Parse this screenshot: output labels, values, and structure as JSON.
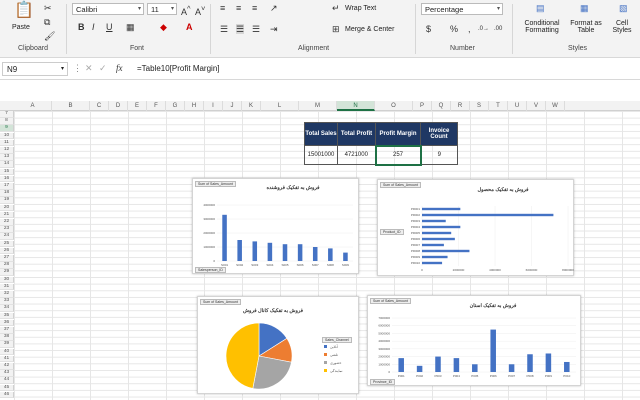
{
  "ribbon": {
    "clipboard": {
      "label": "Clipboard",
      "paste": "Paste"
    },
    "font": {
      "label": "Font",
      "name": "Calibri",
      "size": "11"
    },
    "alignment": {
      "label": "Alignment",
      "wrap": "Wrap Text",
      "merge": "Merge & Center"
    },
    "number": {
      "label": "Number",
      "format": "Percentage"
    },
    "styles": {
      "label": "Styles",
      "conditional": "Conditional Formatting",
      "format_table": "Format as Table",
      "cell_styles": "Cell Styles"
    }
  },
  "formula_bar": {
    "name_box": "N9",
    "fx": "fx",
    "formula": "=Table10[Profit Margin]"
  },
  "columns": [
    "A",
    "B",
    "C",
    "D",
    "E",
    "F",
    "G",
    "H",
    "I",
    "J",
    "K",
    "L",
    "M",
    "N",
    "O",
    "P",
    "Q",
    "R",
    "S",
    "T",
    "U",
    "V",
    "W"
  ],
  "rows": [
    "7",
    "8",
    "9",
    "10",
    "11",
    "12",
    "13",
    "14",
    "15",
    "16",
    "17",
    "18",
    "19",
    "20",
    "21",
    "22",
    "23",
    "24",
    "25",
    "26",
    "27",
    "28",
    "29",
    "30",
    "31",
    "32",
    "33",
    "34",
    "35",
    "36",
    "37",
    "38",
    "39",
    "40",
    "41",
    "42",
    "43",
    "44",
    "45",
    "46"
  ],
  "summary_table": {
    "headers": [
      "Total Sales",
      "Total Profit",
      "Profit Margin",
      "Invoice Count"
    ],
    "values": [
      "15001000",
      "4721000",
      "257",
      "9"
    ]
  },
  "charts": {
    "c1": {
      "title": "فروش به تفکیک فروشنده",
      "tag_top": "Sum of Sales_Amount",
      "tag_bottom": "Salesperson_ID",
      "categories": [
        "S001",
        "S002",
        "S003",
        "S004",
        "S005",
        "S006",
        "S007",
        "S008",
        "S009"
      ],
      "values": [
        3300000,
        1500000,
        1400000,
        1300000,
        1200000,
        1200000,
        1000000,
        900000,
        600000
      ],
      "yticks": [
        "0",
        "1000000",
        "2000000",
        "3000000",
        "4000000"
      ],
      "ymax": 4000000
    },
    "c2": {
      "title": "فروش به تفکیک محصول",
      "tag_top": "Sum of Sales_Amount",
      "tag_left": "Product_ID",
      "categories": [
        "PR001",
        "PR002",
        "PR003",
        "PR004",
        "PR005",
        "PR006",
        "PR007",
        "PR008",
        "PR009",
        "PR010"
      ],
      "values": [
        2100000,
        7200000,
        1300000,
        2100000,
        1600000,
        1800000,
        1200000,
        2600000,
        1400000,
        1100000
      ],
      "xticks": [
        "0",
        "2000000",
        "4000000",
        "6000000",
        "8000000"
      ],
      "xmax": 8000000
    },
    "c3": {
      "title": "فروش به تفکیک کانال فروش",
      "tag_top": "Sum of Sales_Amount",
      "legend_title": "Sales_Channel",
      "slices": [
        {
          "label": "آنلاین",
          "value": 16,
          "color": "#4472c4"
        },
        {
          "label": "تلفنی",
          "value": 12,
          "color": "#ed7d31"
        },
        {
          "label": "حضوری",
          "value": 25,
          "color": "#a5a5a5"
        },
        {
          "label": "نمایندگی",
          "value": 47,
          "color": "#ffc000"
        }
      ]
    },
    "c4": {
      "title": "فروش به تفکیک استان",
      "tag_top": "Sum of Sales_Amount",
      "tag_bottom": "Province_ID",
      "categories": [
        "P001",
        "P002",
        "P003",
        "P004",
        "P005",
        "P006",
        "P007",
        "P008",
        "P009",
        "P010"
      ],
      "values": [
        1800000,
        800000,
        2000000,
        1800000,
        1000000,
        5500000,
        1000000,
        2300000,
        2400000,
        1300000
      ],
      "yticks": [
        "0",
        "1000000",
        "2000000",
        "3000000",
        "4000000",
        "5000000",
        "6000000",
        "7000000"
      ],
      "ymax": 7000000
    }
  }
}
